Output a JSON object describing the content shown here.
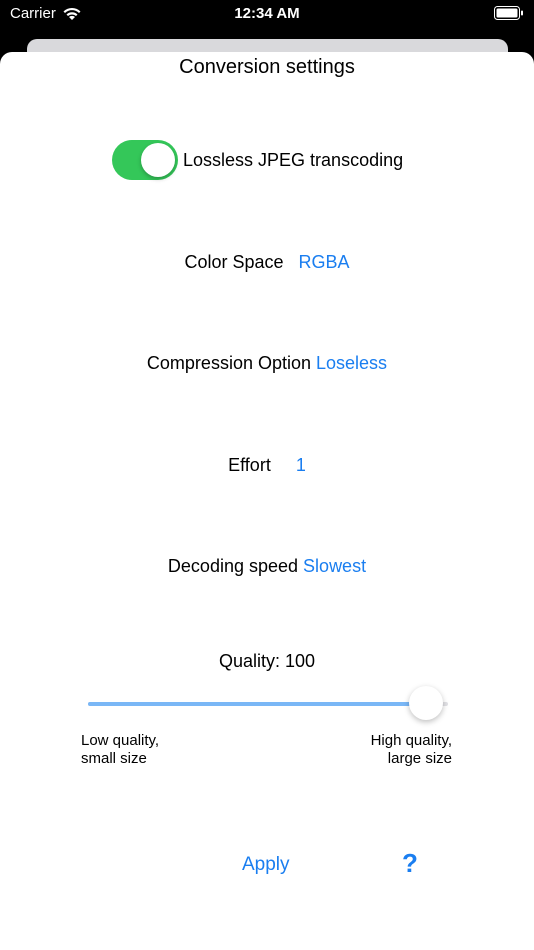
{
  "status_bar": {
    "carrier": "Carrier",
    "time": "12:34 AM"
  },
  "title": "Conversion settings",
  "lossless_toggle": {
    "label": "Lossless JPEG transcoding",
    "on": true
  },
  "color_space": {
    "label": "Color Space",
    "value": "RGBA"
  },
  "compression": {
    "label": "Compression Option",
    "value": "Loseless"
  },
  "effort": {
    "label": "Effort",
    "value": "1"
  },
  "decoding_speed": {
    "label": "Decoding speed",
    "value": "Slowest"
  },
  "quality": {
    "label": "Quality: 100",
    "level_fraction": 0.94
  },
  "captions": {
    "low_line1": "Low quality,",
    "low_line2": "small size",
    "high_line1": "High quality,",
    "high_line2": "large size"
  },
  "actions": {
    "apply": "Apply",
    "help": "?"
  },
  "colors": {
    "accent": "#1a7ef0",
    "toggle_on": "#34c759",
    "slider_fill": "#7ab7f6"
  }
}
